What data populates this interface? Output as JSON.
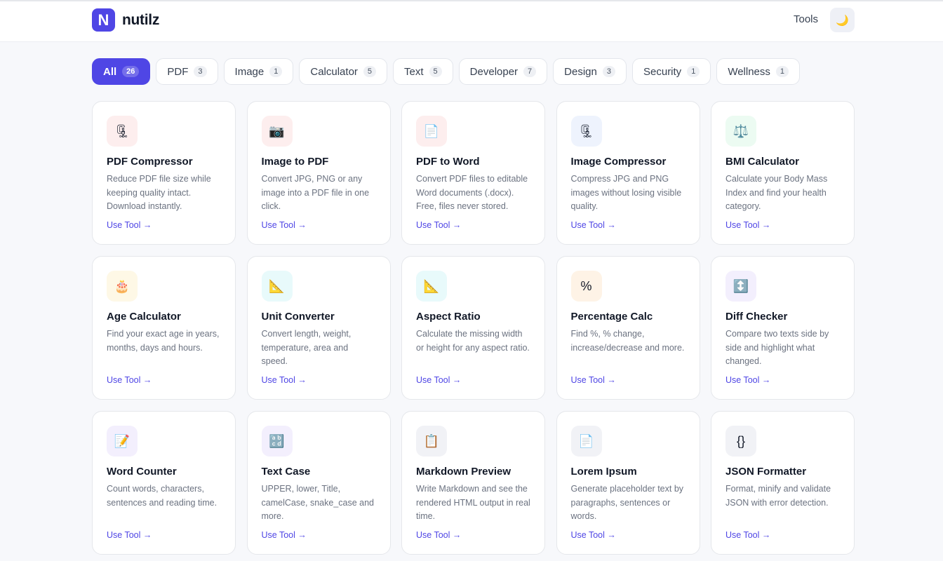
{
  "brand": {
    "logo_letter": "N",
    "name": "nutilz"
  },
  "nav": {
    "tools_label": "Tools",
    "theme_icon": "🌙"
  },
  "filters": [
    {
      "label": "All",
      "count": "26",
      "active": true
    },
    {
      "label": "PDF",
      "count": "3"
    },
    {
      "label": "Image",
      "count": "1"
    },
    {
      "label": "Calculator",
      "count": "5"
    },
    {
      "label": "Text",
      "count": "5"
    },
    {
      "label": "Developer",
      "count": "7"
    },
    {
      "label": "Design",
      "count": "3"
    },
    {
      "label": "Security",
      "count": "1"
    },
    {
      "label": "Wellness",
      "count": "1"
    }
  ],
  "link_label": "Use Tool →",
  "tools": [
    {
      "icon": "🗜",
      "icon_name": "clamp-icon",
      "icon_bg": "#fdeeee",
      "title": "PDF Compressor",
      "desc": "Reduce PDF file size while keeping quality intact. Download instantly."
    },
    {
      "icon": "📷",
      "icon_name": "camera-icon",
      "icon_bg": "#fdeeee",
      "title": "Image to PDF",
      "desc": "Convert JPG, PNG or any image into a PDF file in one click."
    },
    {
      "icon": "📄",
      "icon_name": "document-icon",
      "icon_bg": "#fdeeee",
      "title": "PDF to Word",
      "desc": "Convert PDF files to editable Word documents (.docx). Free, files never stored."
    },
    {
      "icon": "🗜",
      "icon_name": "clamp-icon",
      "icon_bg": "#eef3fd",
      "title": "Image Compressor",
      "desc": "Compress JPG and PNG images without losing visible quality."
    },
    {
      "icon": "⚖️",
      "icon_name": "scale-icon",
      "icon_bg": "#ecfbf2",
      "title": "BMI Calculator",
      "desc": "Calculate your Body Mass Index and find your health category."
    },
    {
      "icon": "🎂",
      "icon_name": "cake-icon",
      "icon_bg": "#fef8e6",
      "title": "Age Calculator",
      "desc": "Find your exact age in years, months, days and hours."
    },
    {
      "icon": "📐",
      "icon_name": "triangle-ruler-icon",
      "icon_bg": "#e8fafb",
      "title": "Unit Converter",
      "desc": "Convert length, weight, temperature, area and speed."
    },
    {
      "icon": "📐",
      "icon_name": "triangle-ruler-icon",
      "icon_bg": "#e8fafb",
      "title": "Aspect Ratio",
      "desc": "Calculate the missing width or height for any aspect ratio."
    },
    {
      "icon": "%",
      "icon_name": "percent-icon",
      "icon_bg": "#fef3e6",
      "title": "Percentage Calc",
      "desc": "Find %, % change, increase/decrease and more."
    },
    {
      "icon": "↕️",
      "icon_name": "up-down-arrow-icon",
      "icon_bg": "#f3effd",
      "title": "Diff Checker",
      "desc": "Compare two texts side by side and highlight what changed."
    },
    {
      "icon": "📝",
      "icon_name": "memo-icon",
      "icon_bg": "#f3effd",
      "title": "Word Counter",
      "desc": "Count words, characters, sentences and reading time."
    },
    {
      "icon": "🔡",
      "icon_name": "abcd-icon",
      "icon_bg": "#f3effd",
      "title": "Text Case",
      "desc": "UPPER, lower, Title, camelCase, snake_case and more."
    },
    {
      "icon": "📋",
      "icon_name": "clipboard-icon",
      "icon_bg": "#f1f2f6",
      "title": "Markdown Preview",
      "desc": "Write Markdown and see the rendered HTML output in real time."
    },
    {
      "icon": "📄",
      "icon_name": "document-icon",
      "icon_bg": "#f1f2f6",
      "title": "Lorem Ipsum",
      "desc": "Generate placeholder text by paragraphs, sentences or words."
    },
    {
      "icon": "{}",
      "icon_name": "braces-icon",
      "icon_bg": "#f1f2f6",
      "title": "JSON Formatter",
      "desc": "Format, minify and validate JSON with error detection."
    }
  ]
}
